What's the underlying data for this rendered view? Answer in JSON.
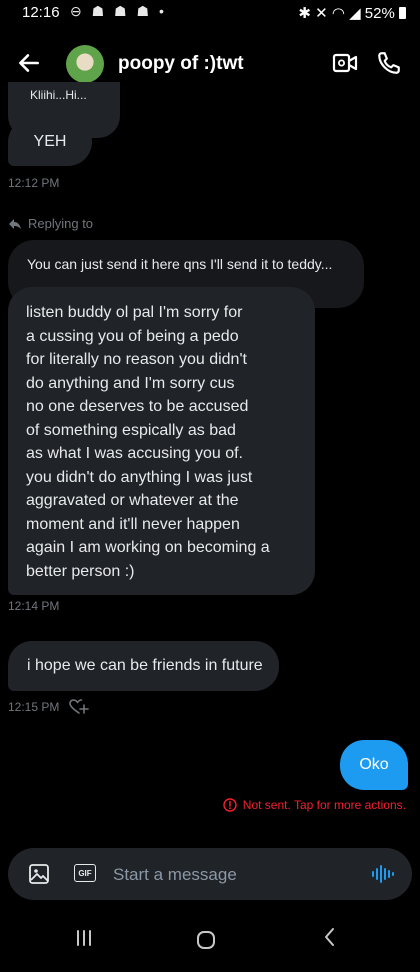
{
  "status_bar": {
    "time": "12:16",
    "battery": "52%"
  },
  "header": {
    "contact_name": "poopy of :)twt"
  },
  "messages": {
    "truncated_text": "Kliihi...Hi...",
    "yeh": "YEH",
    "yeh_time": "12:12 PM",
    "reply_label": "Replying to",
    "quoted_text": "You can just send it here qns I'll send it to teddy...",
    "long_message": "listen buddy ol pal I'm sorry for\na cussing you of being a pedo\nfor literally no reason you didn't\ndo anything and I'm sorry cus\nno one deserves to be accused\nof something espically as bad\nas what I was accusing you of.\nyou didn't do anything I was just\naggravated or whatever at the\nmoment and it'll never happen\nagain I am working on becoming a\nbetter person :)",
    "long_time": "12:14 PM",
    "hope_message": "i hope we can be friends in future",
    "hope_time": "12:15 PM",
    "sent_message": "Oko",
    "not_sent": "Not sent. Tap for more actions."
  },
  "composer": {
    "placeholder": "Start a message",
    "gif_label": "GIF"
  },
  "colors": {
    "accent": "#1d9bf0",
    "error": "#f4212e",
    "bubble": "#202327"
  }
}
